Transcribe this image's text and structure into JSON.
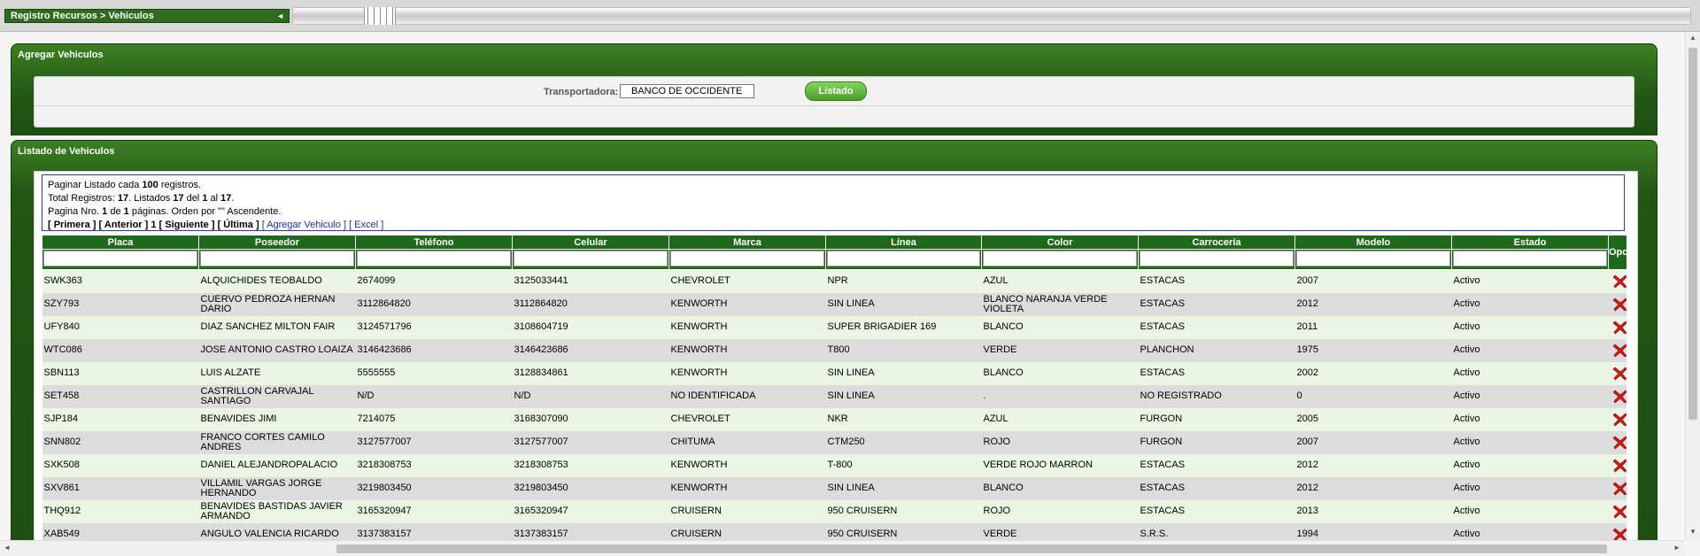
{
  "breadcrumb": {
    "label": "Registro Recursos > Vehiculos",
    "collapse_glyph": "◄"
  },
  "panel_add": {
    "title": "Agregar Vehiculos",
    "transportadora_label": "Transportadora:",
    "transportadora_value": "BANCO DE OCCIDENTE",
    "listado_button": "Listado"
  },
  "panel_list": {
    "title": "Listado de Vehiculos",
    "info": {
      "line1_pre": "Paginar Listado cada ",
      "page_size": "100",
      "line1_post": " registros.",
      "line2_a": "Total Registros: ",
      "total": "17",
      "line2_b": ". Listados ",
      "listed": "17",
      "line2_c": " del ",
      "from": "1",
      "line2_d": " al ",
      "to": "17",
      "line2_e": ".",
      "line3_a": "Pagina Nro. ",
      "page": "1",
      "line3_b": " de ",
      "pages": "1",
      "line3_c": " páginas. Orden por \"\" Ascendente.",
      "nav_first": "[ Primera ]",
      "nav_prev": "[ Anterior ]",
      "nav_current": "1",
      "nav_next": "[ Siguiente ]",
      "nav_last": "[ Última ]",
      "nav_add": "[ Agregar Vehiculo ]",
      "nav_excel": "[ Excel ]"
    },
    "columns": [
      "Placa",
      "Poseedor",
      "Teléfono",
      "Celular",
      "Marca",
      "Línea",
      "Color",
      "Carrocería",
      "Modelo",
      "Estado",
      "Opciones"
    ],
    "rows": [
      [
        "SWK363",
        "ALQUICHIDES TEOBALDO",
        "2674099",
        "3125033441",
        "CHEVROLET",
        "NPR",
        "AZUL",
        "ESTACAS",
        "2007",
        "Activo"
      ],
      [
        "SZY793",
        "CUERVO PEDROZA HERNAN DARIO",
        "3112864820",
        "3112864820",
        "KENWORTH",
        "SIN LINEA",
        "BLANCO NARANJA VERDE VIOLETA",
        "ESTACAS",
        "2012",
        "Activo"
      ],
      [
        "UFY840",
        "DIAZ SANCHEZ MILTON FAIR",
        "3124571796",
        "3108604719",
        "KENWORTH",
        "SUPER BRIGADIER 169",
        "BLANCO",
        "ESTACAS",
        "2011",
        "Activo"
      ],
      [
        "WTC086",
        "JOSE ANTONIO CASTRO LOAIZA",
        "3146423686",
        "3146423686",
        "KENWORTH",
        "T800",
        "VERDE",
        "PLANCHON",
        "1975",
        "Activo"
      ],
      [
        "SBN113",
        "LUIS ALZATE",
        "5555555",
        "3128834861",
        "KENWORTH",
        "SIN LINEA",
        "BLANCO",
        "ESTACAS",
        "2002",
        "Activo"
      ],
      [
        "SET458",
        "CASTRILLON CARVAJAL SANTIAGO",
        "N/D",
        "N/D",
        "NO IDENTIFICADA",
        "SIN LINEA",
        ".",
        "NO REGISTRADO",
        "0",
        "Activo"
      ],
      [
        "SJP184",
        "BENAVIDES JIMI",
        "7214075",
        "3168307090",
        "CHEVROLET",
        "NKR",
        "AZUL",
        "FURGON",
        "2005",
        "Activo"
      ],
      [
        "SNN802",
        "FRANCO CORTES CAMILO ANDRES",
        "3127577007",
        "3127577007",
        "CHITUMA",
        "CTM250",
        "ROJO",
        "FURGON",
        "2007",
        "Activo"
      ],
      [
        "SXK508",
        "DANIEL ALEJANDROPALACIO",
        "3218308753",
        "3218308753",
        "KENWORTH",
        "T-800",
        "VERDE ROJO MARRON",
        "ESTACAS",
        "2012",
        "Activo"
      ],
      [
        "SXV861",
        "VILLAMIL VARGAS JORGE HERNANDO",
        "3219803450",
        "3219803450",
        "KENWORTH",
        "SIN LINEA",
        "BLANCO",
        "ESTACAS",
        "2012",
        "Activo"
      ],
      [
        "THQ912",
        "BENAVIDES BASTIDAS JAVIER ARMANDO",
        "3165320947",
        "3165320947",
        "CRUISERN",
        "950 CRUISERN",
        "ROJO",
        "ESTACAS",
        "2013",
        "Activo"
      ],
      [
        "XAB549",
        "ANGULO VALENCIA RICARDO",
        "3137383157",
        "3137383157",
        "CRUISERN",
        "950 CRUISERN",
        "VERDE",
        "S.R.S.",
        "1994",
        "Activo"
      ]
    ],
    "option_icons": [
      "delete-icon",
      "edit-icon"
    ]
  },
  "colors": {
    "panel_green": "#235514",
    "header_green": "#1e6a1a",
    "row_odd": "#eaf5e3",
    "row_even": "#dcdcdc",
    "link": "#1a2ec0"
  }
}
